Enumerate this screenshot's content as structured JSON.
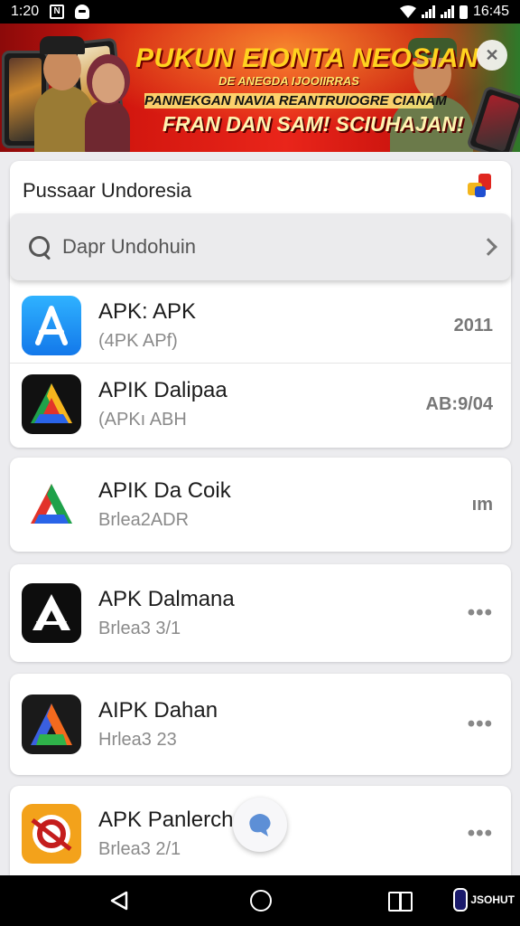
{
  "status_bar": {
    "time": "1:20",
    "nfc_label": "N",
    "right_time": "16:45"
  },
  "banner": {
    "headline": "PUKUN EIONTA NEOSIAN",
    "line2": "DE ANEGDA IJOOIIRRAS",
    "line3": "PANNEKGAN NAVIA REANTRUIOGRE CIANAM",
    "line4": "FRAN DAN SAM! SCIUHAJAN!",
    "close_glyph": "✕"
  },
  "header": {
    "title": "Pussaar Undoresia"
  },
  "search": {
    "placeholder": "Dapr Undohuin"
  },
  "apps": [
    {
      "name": "APK: APK",
      "sub": "(4PK APf)",
      "meta": "2011",
      "icon": "app-store-icon",
      "color": "#1a9af5"
    },
    {
      "name": "APIK Dalipaa",
      "sub": "(APKı ABH",
      "meta": "AB:9/04",
      "icon": "drive-triangle-icon",
      "color": "#111111"
    },
    {
      "name": "APIK Da Coik",
      "sub": "Brlea2ADR",
      "meta": "ım",
      "icon": "triangle-logo-icon",
      "color": "#ffffff"
    },
    {
      "name": "APK Dalmana",
      "sub": "Brlea3 3/1",
      "meta": "•••",
      "icon": "a-logo-icon",
      "color": "#0d0d0d"
    },
    {
      "name": "AIPK Dahan",
      "sub": "Hrlea3 23",
      "meta": "•••",
      "icon": "colorful-a-icon",
      "color": "#1a1a1a"
    },
    {
      "name": "APK Panlerch",
      "sub": "Brlea3 2/1",
      "meta": "•••",
      "icon": "compass-logo-icon",
      "color": "#f3a21b"
    }
  ],
  "nav": {
    "corner_label": "JSOHUT"
  }
}
